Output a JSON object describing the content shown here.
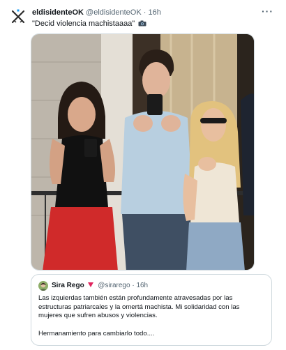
{
  "tweet": {
    "author_name": "eldisidenteOK",
    "author_handle": "@eldisidenteOK",
    "separator": "·",
    "time": "16h",
    "text": "\"Decid violencia machistaaaa\"",
    "more_label": "···"
  },
  "quoted": {
    "author_name": "Sira Rego",
    "author_handle": "@sirarego",
    "separator": "·",
    "time": "16h",
    "lines": [
      "Las izquierdas también están profundamente atravesadas por las",
      "estructuras patriarcales y la omertá machista. Mi solidaridad con las",
      "mujeres que sufren abusos y violencias."
    ],
    "closing": "Hermanamiento para cambiarlo todo...."
  },
  "icons": {
    "avatar": "crossed-swords-logo",
    "camera": "camera-emoji",
    "flag": "red-triangle-flag",
    "more": "ellipsis-icon"
  },
  "colors": {
    "secondary_text": "#536471",
    "border": "#cfd9de"
  }
}
